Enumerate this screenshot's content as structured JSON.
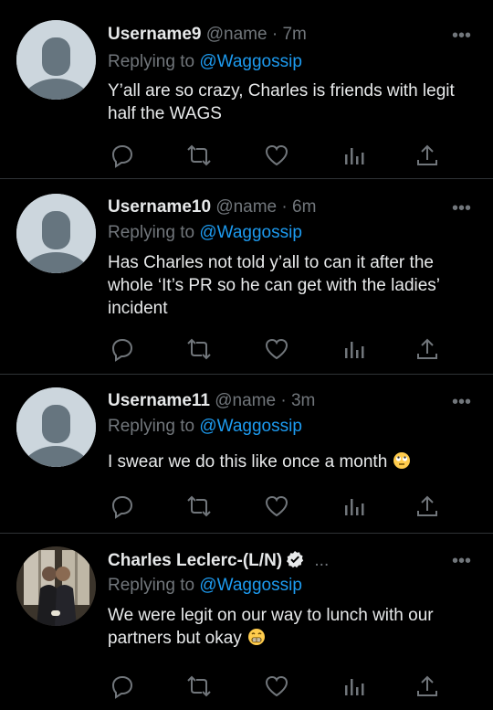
{
  "colors": {
    "background": "#000000",
    "text": "#e7e9ea",
    "muted": "#71767b",
    "link": "#1d9bf0",
    "divider": "#2f3336"
  },
  "tweets": [
    {
      "name": "Username9",
      "handle": "@name",
      "sep": "·",
      "time": "7m",
      "replying_prefix": "Replying to",
      "replying_handle": "@Waggossip",
      "text": "Y’all are so crazy, Charles is friends with legit half the WAGS",
      "more": "•••",
      "avatar": "default-avatar-icon"
    },
    {
      "name": "Username10",
      "handle": "@name",
      "sep": "·",
      "time": "6m",
      "replying_prefix": "Replying to",
      "replying_handle": "@Waggossip",
      "text": "Has Charles not told y’all to can it after the whole ‘It’s PR so he can get with the ladies’ incident",
      "more": "•••",
      "avatar": "default-avatar-icon"
    },
    {
      "name": "Username11",
      "handle": "@name",
      "sep": "·",
      "time": "3m",
      "replying_prefix": "Replying to",
      "replying_handle": "@Waggossip",
      "text": "I swear we do this like once a month",
      "emoji": "eye-roll-emoji",
      "more": "•••",
      "avatar": "default-avatar-icon"
    },
    {
      "name": "Charles Leclerc-(L/N)",
      "verified": "verified-badge-icon",
      "ellipsis": "...",
      "replying_prefix": "Replying to",
      "replying_handle": "@Waggossip",
      "text": "We were legit on our way to lunch with our partners but okay",
      "emoji": "grimacing-smile-emoji",
      "more": "•••",
      "avatar": "photo-avatar"
    }
  ],
  "actions": [
    "reply-icon",
    "retweet-icon",
    "like-icon",
    "analytics-icon",
    "share-icon"
  ]
}
